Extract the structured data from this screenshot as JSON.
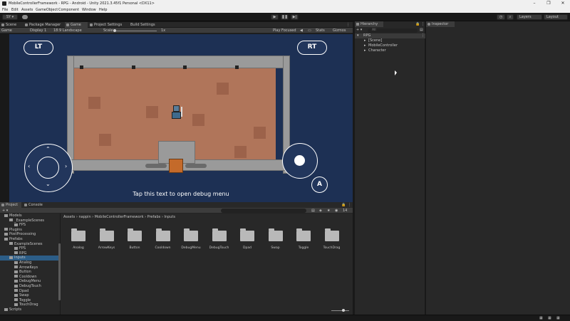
{
  "window": {
    "title": "MobileControllerFramework - RPG - Android - Unity 2021.3.45f1 Personal <DX11>",
    "controls": [
      "–",
      "❐",
      "✕"
    ]
  },
  "menu": [
    "File",
    "Edit",
    "Assets",
    "GameObject",
    "Component",
    "Window",
    "Help"
  ],
  "toolbar": {
    "account": "SY",
    "layers": "Layers",
    "layout": "Layout"
  },
  "scene_tabs": [
    "Scene",
    "Package Manager",
    "Game",
    "Project Settings",
    "Build Settings"
  ],
  "game_bar": {
    "mode": "Game",
    "display": "Display 1",
    "resolution": "18:9 Landscape",
    "scale_label": "Scale",
    "scale_value": "1x",
    "play_focused": "Play Focused",
    "stats": "Stats",
    "gizmos": "Gizmos"
  },
  "game": {
    "lt": "LT",
    "rt": "RT",
    "a_button": "A",
    "debug_text": "Tap this text to open debug menu"
  },
  "bottom_tabs": [
    "Project",
    "Console"
  ],
  "project": {
    "breadcrumb": [
      "Assets",
      "nappin",
      "MobileControllerFramework",
      "Prefabs",
      "Inputs"
    ],
    "count": "14",
    "tree": [
      {
        "label": "Models",
        "indent": 0
      },
      {
        "label": "_ExampleScenes",
        "indent": 1
      },
      {
        "label": "FPS",
        "indent": 2
      },
      {
        "label": "Plugins",
        "indent": 0
      },
      {
        "label": "PostProcessing",
        "indent": 0
      },
      {
        "label": "Prefabs",
        "indent": 0
      },
      {
        "label": "ExampleScenes",
        "indent": 1
      },
      {
        "label": "FPS",
        "indent": 2
      },
      {
        "label": "RPG",
        "indent": 2
      },
      {
        "label": "Inputs",
        "indent": 1
      },
      {
        "label": "Analog",
        "indent": 2
      },
      {
        "label": "ArrowKeys",
        "indent": 2
      },
      {
        "label": "Button",
        "indent": 2
      },
      {
        "label": "Cooldown",
        "indent": 2
      },
      {
        "label": "DebugMenu",
        "indent": 2
      },
      {
        "label": "DebugTouch",
        "indent": 2
      },
      {
        "label": "Dpad",
        "indent": 2
      },
      {
        "label": "Swap",
        "indent": 2
      },
      {
        "label": "Toggle",
        "indent": 2
      },
      {
        "label": "TouchDrag",
        "indent": 2
      },
      {
        "label": "Scripts",
        "indent": 0
      }
    ],
    "folders": [
      "Analog",
      "ArrowKeys",
      "Button",
      "Cooldown",
      "DebugMenu",
      "DebugTouch",
      "Dpad",
      "Swap",
      "Toggle",
      "TouchDrag"
    ]
  },
  "hierarchy": {
    "tab": "Hierarchy",
    "search_placeholder": "All",
    "root": "RPG",
    "children": [
      "[Scene]",
      "MobileController",
      "Character"
    ]
  },
  "inspector": {
    "tab": "Inspector"
  }
}
